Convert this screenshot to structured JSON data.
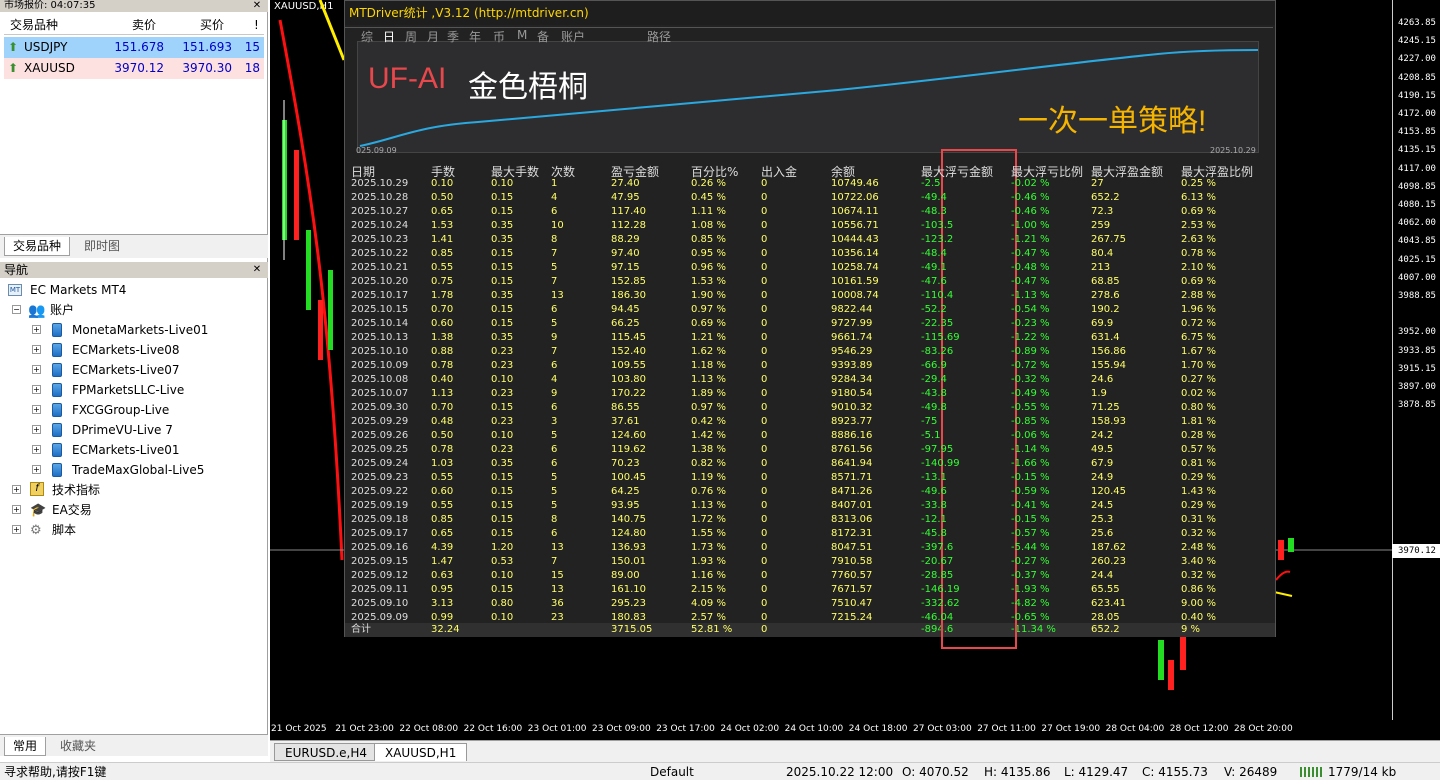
{
  "market_watch": {
    "title": "市场报价: 04:07:35",
    "columns": [
      "交易品种",
      "卖价",
      "买价",
      "!"
    ],
    "rows": [
      {
        "symbol": "USDJPY",
        "bid": "151.678",
        "ask": "151.693",
        "spread": "15",
        "bg": "#9fd3fb"
      },
      {
        "symbol": "XAUUSD",
        "bid": "3970.12",
        "ask": "3970.30",
        "spread": "18",
        "bg": "#fde0e0"
      }
    ],
    "tabs": [
      "交易品种",
      "即时图"
    ]
  },
  "navigator": {
    "title": "导航",
    "root": "EC Markets MT4",
    "accounts_label": "账户",
    "accounts": [
      "MonetaMarkets-Live01",
      "ECMarkets-Live08",
      "ECMarkets-Live07",
      "FPMarketsLLC-Live",
      "FXCGGroup-Live",
      "DPrimeVU-Live 7",
      "ECMarkets-Live01",
      "TradeMaxGlobal-Live5"
    ],
    "indicators_label": "技术指标",
    "ea_label": "EA交易",
    "scripts_label": "脚本",
    "bottom_tabs": [
      "常用",
      "收藏夹"
    ]
  },
  "chart": {
    "window_label": "XAUUSD,H1",
    "price_ticks": [
      "4263.85",
      "4245.15",
      "4227.00",
      "4208.85",
      "4190.15",
      "4172.00",
      "4153.85",
      "4135.15",
      "4117.00",
      "4098.85",
      "4080.15",
      "4062.00",
      "4043.85",
      "4025.15",
      "4007.00",
      "3988.85",
      "3970.12",
      "3952.00",
      "3933.85",
      "3915.15",
      "3897.00",
      "3878.85"
    ],
    "time_ticks": [
      "21 Oct 2025",
      "21 Oct 23:00",
      "22 Oct 08:00",
      "22 Oct 16:00",
      "23 Oct 01:00",
      "23 Oct 09:00",
      "23 Oct 17:00",
      "24 Oct 02:00",
      "24 Oct 10:00",
      "24 Oct 18:00",
      "27 Oct 03:00",
      "27 Oct 11:00",
      "27 Oct 19:00",
      "28 Oct 04:00",
      "28 Oct 12:00",
      "28 Oct 20:00"
    ]
  },
  "mtdriver": {
    "title": "MTDriver统计 ,V3.12 (http://mtdriver.cn)",
    "period_tabs": [
      "综",
      "日",
      "周",
      "月",
      "季",
      "年",
      "币",
      "M",
      "备",
      "账户",
      "路径"
    ],
    "active_tab": "日",
    "brand": "UF-AI",
    "brand_sub": "金色梧桐",
    "slogan": "一次一单策略!",
    "curve_start": "025.09.09",
    "curve_end": "2025.10.29",
    "headers": [
      "日期",
      "手数",
      "最大手数",
      "次数",
      "盈亏金额",
      "百分比%",
      "出入金",
      "余额",
      "最大浮亏金额",
      "最大浮亏比例",
      "最大浮盈金额",
      "最大浮盈比例"
    ],
    "rows": [
      [
        "2025.10.29",
        "0.10",
        "0.10",
        "1",
        "27.40",
        "0.26 %",
        "0",
        "10749.46",
        "-2.5",
        "-0.02 %",
        "27",
        "0.25 %"
      ],
      [
        "2025.10.28",
        "0.50",
        "0.15",
        "4",
        "47.95",
        "0.45 %",
        "0",
        "10722.06",
        "-49.4",
        "-0.46 %",
        "652.2",
        "6.13 %"
      ],
      [
        "2025.10.27",
        "0.65",
        "0.15",
        "6",
        "117.40",
        "1.11 %",
        "0",
        "10674.11",
        "-48.3",
        "-0.46 %",
        "72.3",
        "0.69 %"
      ],
      [
        "2025.10.24",
        "1.53",
        "0.35",
        "10",
        "112.28",
        "1.08 %",
        "0",
        "10556.71",
        "-103.5",
        "-1.00 %",
        "259",
        "2.53 %"
      ],
      [
        "2025.10.23",
        "1.41",
        "0.35",
        "8",
        "88.29",
        "0.85 %",
        "0",
        "10444.43",
        "-123.2",
        "-1.21 %",
        "267.75",
        "2.63 %"
      ],
      [
        "2025.10.22",
        "0.85",
        "0.15",
        "7",
        "97.40",
        "0.95 %",
        "0",
        "10356.14",
        "-48.4",
        "-0.47 %",
        "80.4",
        "0.78 %"
      ],
      [
        "2025.10.21",
        "0.55",
        "0.15",
        "5",
        "97.15",
        "0.96 %",
        "0",
        "10258.74",
        "-49.1",
        "-0.48 %",
        "213",
        "2.10 %"
      ],
      [
        "2025.10.20",
        "0.75",
        "0.15",
        "7",
        "152.85",
        "1.53 %",
        "0",
        "10161.59",
        "-47.6",
        "-0.47 %",
        "68.85",
        "0.69 %"
      ],
      [
        "2025.10.17",
        "1.78",
        "0.35",
        "13",
        "186.30",
        "1.90 %",
        "0",
        "10008.74",
        "-110.4",
        "-1.13 %",
        "278.6",
        "2.88 %"
      ],
      [
        "2025.10.15",
        "0.70",
        "0.15",
        "6",
        "94.45",
        "0.97 %",
        "0",
        "9822.44",
        "-52.2",
        "-0.54 %",
        "190.2",
        "1.96 %"
      ],
      [
        "2025.10.14",
        "0.60",
        "0.15",
        "5",
        "66.25",
        "0.69 %",
        "0",
        "9727.99",
        "-22.35",
        "-0.23 %",
        "69.9",
        "0.72 %"
      ],
      [
        "2025.10.13",
        "1.38",
        "0.35",
        "9",
        "115.45",
        "1.21 %",
        "0",
        "9661.74",
        "-115.69",
        "-1.22 %",
        "631.4",
        "6.75 %"
      ],
      [
        "2025.10.10",
        "0.88",
        "0.23",
        "7",
        "152.40",
        "1.62 %",
        "0",
        "9546.29",
        "-83.26",
        "-0.89 %",
        "156.86",
        "1.67 %"
      ],
      [
        "2025.10.09",
        "0.78",
        "0.23",
        "6",
        "109.55",
        "1.18 %",
        "0",
        "9393.89",
        "-66.9",
        "-0.72 %",
        "155.94",
        "1.70 %"
      ],
      [
        "2025.10.08",
        "0.40",
        "0.10",
        "4",
        "103.80",
        "1.13 %",
        "0",
        "9284.34",
        "-29.4",
        "-0.32 %",
        "24.6",
        "0.27 %"
      ],
      [
        "2025.10.07",
        "1.13",
        "0.23",
        "9",
        "170.22",
        "1.89 %",
        "0",
        "9180.54",
        "-43.8",
        "-0.49 %",
        "1.9",
        "0.02 %"
      ],
      [
        "2025.09.30",
        "0.70",
        "0.15",
        "6",
        "86.55",
        "0.97 %",
        "0",
        "9010.32",
        "-49.8",
        "-0.55 %",
        "71.25",
        "0.80 %"
      ],
      [
        "2025.09.29",
        "0.48",
        "0.23",
        "3",
        "37.61",
        "0.42 %",
        "0",
        "8923.77",
        "-75",
        "-0.85 %",
        "158.93",
        "1.81 %"
      ],
      [
        "2025.09.26",
        "0.50",
        "0.10",
        "5",
        "124.60",
        "1.42 %",
        "0",
        "8886.16",
        "-5.1",
        "-0.06 %",
        "24.2",
        "0.28 %"
      ],
      [
        "2025.09.25",
        "0.78",
        "0.23",
        "6",
        "119.62",
        "1.38 %",
        "0",
        "8761.56",
        "-97.95",
        "-1.14 %",
        "49.5",
        "0.57 %"
      ],
      [
        "2025.09.24",
        "1.03",
        "0.35",
        "6",
        "70.23",
        "0.82 %",
        "0",
        "8641.94",
        "-140.99",
        "-1.66 %",
        "67.9",
        "0.81 %"
      ],
      [
        "2025.09.23",
        "0.55",
        "0.15",
        "5",
        "100.45",
        "1.19 %",
        "0",
        "8571.71",
        "-13.1",
        "-0.15 %",
        "24.9",
        "0.29 %"
      ],
      [
        "2025.09.22",
        "0.60",
        "0.15",
        "5",
        "64.25",
        "0.76 %",
        "0",
        "8471.26",
        "-49.6",
        "-0.59 %",
        "120.45",
        "1.43 %"
      ],
      [
        "2025.09.19",
        "0.55",
        "0.15",
        "5",
        "93.95",
        "1.13 %",
        "0",
        "8407.01",
        "-33.8",
        "-0.41 %",
        "24.5",
        "0.29 %"
      ],
      [
        "2025.09.18",
        "0.85",
        "0.15",
        "8",
        "140.75",
        "1.72 %",
        "0",
        "8313.06",
        "-12.1",
        "-0.15 %",
        "25.3",
        "0.31 %"
      ],
      [
        "2025.09.17",
        "0.65",
        "0.15",
        "6",
        "124.80",
        "1.55 %",
        "0",
        "8172.31",
        "-45.8",
        "-0.57 %",
        "25.6",
        "0.32 %"
      ],
      [
        "2025.09.16",
        "4.39",
        "1.20",
        "13",
        "136.93",
        "1.73 %",
        "0",
        "8047.51",
        "-397.6",
        "-5.44 %",
        "187.62",
        "2.48 %"
      ],
      [
        "2025.09.15",
        "1.47",
        "0.53",
        "7",
        "150.01",
        "1.93 %",
        "0",
        "7910.58",
        "-20.67",
        "-0.27 %",
        "260.23",
        "3.40 %"
      ],
      [
        "2025.09.12",
        "0.63",
        "0.10",
        "15",
        "89.00",
        "1.16 %",
        "0",
        "7760.57",
        "-28.85",
        "-0.37 %",
        "24.4",
        "0.32 %"
      ],
      [
        "2025.09.11",
        "0.95",
        "0.15",
        "13",
        "161.10",
        "2.15 %",
        "0",
        "7671.57",
        "-146.19",
        "-1.93 %",
        "65.55",
        "0.86 %"
      ],
      [
        "2025.09.10",
        "3.13",
        "0.80",
        "36",
        "295.23",
        "4.09 %",
        "0",
        "7510.47",
        "-332.62",
        "-4.82 %",
        "623.41",
        "9.00 %"
      ],
      [
        "2025.09.09",
        "0.99",
        "0.10",
        "23",
        "180.83",
        "2.57 %",
        "0",
        "7215.24",
        "-46.04",
        "-0.65 %",
        "28.05",
        "0.40 %"
      ]
    ],
    "total": [
      "合计",
      "32.24",
      "",
      "",
      "3715.05",
      "52.81 %",
      "0",
      "",
      "-894.6",
      "-11.34 %",
      "652.2",
      "9 %"
    ]
  },
  "chart_tabs": [
    "EURUSD.e,H4",
    "XAUUSD,H1"
  ],
  "active_chart_tab": "XAUUSD,H1",
  "status": {
    "help": "寻求帮助,请按F1键",
    "profile": "Default",
    "datetime": "2025.10.22 12:00",
    "open": "O: 4070.52",
    "high": "H: 4135.86",
    "low": "L: 4129.47",
    "close": "C: 4155.73",
    "volume": "V: 26489",
    "traffic": "1779/14 kb"
  },
  "colors": {
    "accent_yellow": "#ffff66",
    "green": "#33ff33",
    "brand_red": "#e8474c",
    "slogan_gold": "#f5b400",
    "curve_blue": "#29a9e0"
  }
}
